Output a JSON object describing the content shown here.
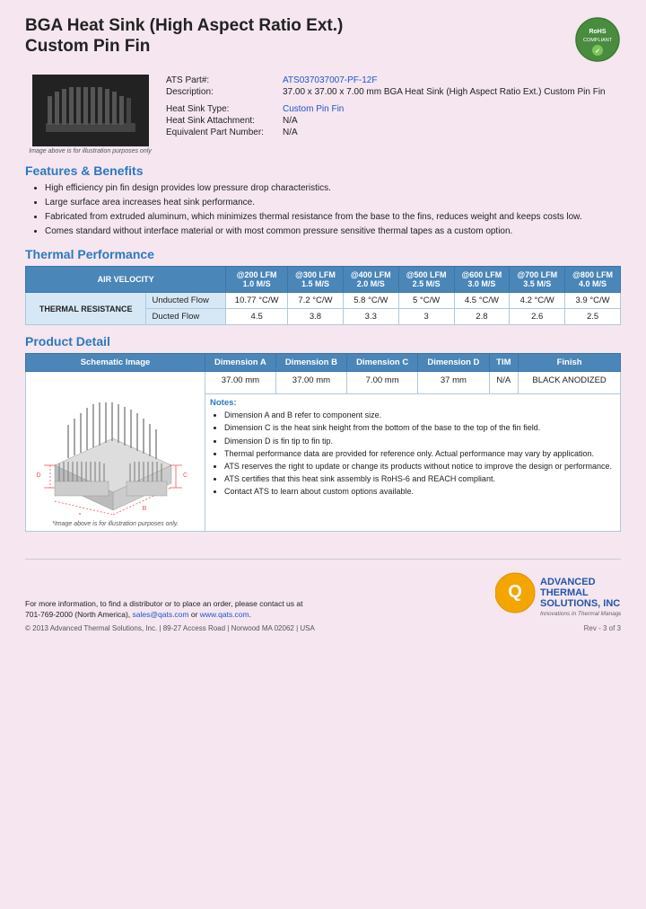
{
  "title": {
    "line1": "BGA Heat Sink (High Aspect Ratio Ext.)",
    "line2": "Custom Pin Fin"
  },
  "rohs": "RoHS\nCOMPLIANT",
  "image_caption": "Image above is for illustration purposes only",
  "specs": {
    "part_label": "ATS Part#:",
    "part_value": "ATS037037007-PF-12F",
    "desc_label": "Description:",
    "desc_value": "37.00 x 37.00 x 7.00 mm  BGA Heat Sink (High Aspect Ratio Ext.) Custom Pin Fin",
    "type_label": "Heat Sink Type:",
    "type_value": "Custom Pin Fin",
    "attach_label": "Heat Sink Attachment:",
    "attach_value": "N/A",
    "equiv_label": "Equivalent Part Number:",
    "equiv_value": "N/A"
  },
  "features": {
    "heading": "Features & Benefits",
    "items": [
      "High efficiency pin fin design provides low pressure drop characteristics.",
      "Large surface area increases heat sink performance.",
      "Fabricated from extruded aluminum, which minimizes thermal resistance from the base to the fins, reduces weight and keeps costs low.",
      "Comes standard without interface material or with most common pressure sensitive thermal tapes as a custom option."
    ]
  },
  "thermal": {
    "heading": "Thermal Performance",
    "col_header": "AIR VELOCITY",
    "columns": [
      {
        "speed": "@200 LFM",
        "ms": "1.0 M/S"
      },
      {
        "speed": "@300 LFM",
        "ms": "1.5 M/S"
      },
      {
        "speed": "@400 LFM",
        "ms": "2.0 M/S"
      },
      {
        "speed": "@500 LFM",
        "ms": "2.5 M/S"
      },
      {
        "speed": "@600 LFM",
        "ms": "3.0 M/S"
      },
      {
        "speed": "@700 LFM",
        "ms": "3.5 M/S"
      },
      {
        "speed": "@800 LFM",
        "ms": "4.0 M/S"
      }
    ],
    "row_section": "THERMAL RESISTANCE",
    "rows": [
      {
        "label": "Unducted Flow",
        "values": [
          "10.77 °C/W",
          "7.2 °C/W",
          "5.8 °C/W",
          "5 °C/W",
          "4.5 °C/W",
          "4.2 °C/W",
          "3.9 °C/W"
        ]
      },
      {
        "label": "Ducted Flow",
        "values": [
          "4.5",
          "3.8",
          "3.3",
          "3",
          "2.8",
          "2.6",
          "2.5"
        ]
      }
    ]
  },
  "product_detail": {
    "heading": "Product Detail",
    "schematic_label": "Schematic Image",
    "columns": [
      "Dimension A",
      "Dimension B",
      "Dimension C",
      "Dimension D",
      "TIM",
      "Finish"
    ],
    "values": [
      "37.00 mm",
      "37.00 mm",
      "7.00 mm",
      "37 mm",
      "N/A",
      "BLACK ANODIZED"
    ],
    "schematic_caption": "*Image above is for illustration purposes only.",
    "notes_label": "Notes:",
    "notes": [
      "Dimension A and B refer to component size.",
      "Dimension C is the heat sink height from the bottom of the base to the top of the fin field.",
      "Dimension D is fin tip to fin tip.",
      "Thermal performance data are provided for reference only. Actual performance may vary by application.",
      "ATS reserves the right to update or change its products without notice to improve the design or performance.",
      "ATS certifies that this heat sink assembly is RoHS-6 and REACH compliant.",
      "Contact ATS to learn about custom options available."
    ]
  },
  "footer": {
    "contact_text": "For more information, to find a distributor or to place an order, please contact us at\n701-769-2000 (North America), sales@qats.com or www.qats.com.",
    "copyright": "© 2013 Advanced Thermal Solutions, Inc.  |  89-27 Access Road  |  Norwood MA  02062  |  USA",
    "ats_brand": "ADVANCED\nTHERMAL\nSOLUTIONS, INC.",
    "ats_tagline": "Innovations in Thermal Management®",
    "page_num": "Rev - 3 of 3"
  }
}
